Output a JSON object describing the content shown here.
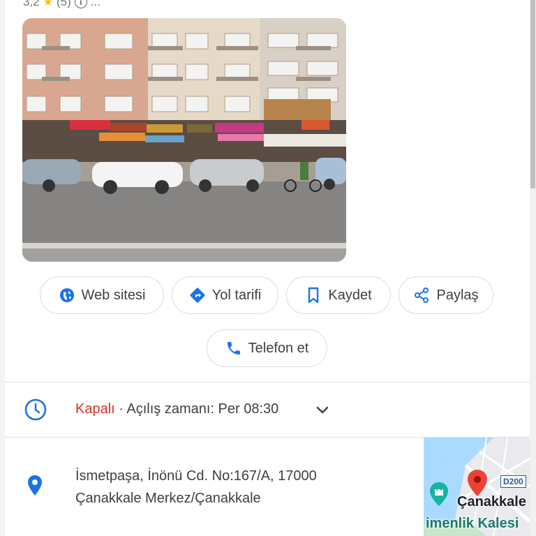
{
  "rating": {
    "value": "3,2",
    "star": "★",
    "count": "(5)",
    "more": "..."
  },
  "actions": [
    {
      "label": "Web sitesi",
      "icon": "globe-icon"
    },
    {
      "label": "Yol tarifi",
      "icon": "directions-icon"
    },
    {
      "label": "Kaydet",
      "icon": "bookmark-icon"
    },
    {
      "label": "Paylaş",
      "icon": "share-icon"
    },
    {
      "label": "Telefon et",
      "icon": "phone-icon"
    }
  ],
  "hours": {
    "status": "Kapalı",
    "separator": " · ",
    "detail": "Açılış zamanı: Per 08:30"
  },
  "address": {
    "line1": "İsmetpaşa, İnönü Cd. No:167/A, 17000",
    "line2": "Çanakkale Merkez/Çanakkale"
  },
  "map": {
    "city_label": "Çanakkale",
    "poi_label": "imenlik Kalesi",
    "road_badge": "D200"
  },
  "colors": {
    "accent": "#1a73e8",
    "closed": "#d93025",
    "pin": "#ea4335"
  }
}
